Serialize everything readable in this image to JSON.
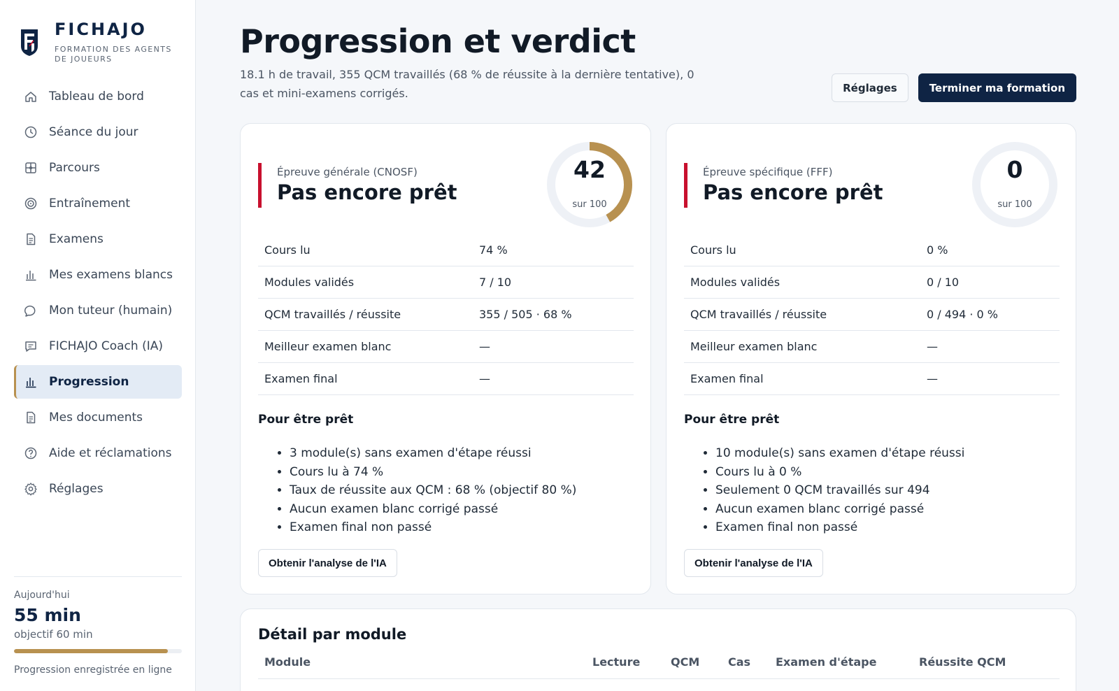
{
  "brand": {
    "name": "FICHAJO",
    "tagline": "FORMATION DES AGENTS DE JOUEURS",
    "colors": {
      "navy": "#0f2444",
      "gold": "#b89150",
      "red": "#c8102e"
    }
  },
  "sidebar": {
    "items": [
      {
        "label": "Tableau de bord",
        "icon": "home-icon",
        "active": false
      },
      {
        "label": "Séance du jour",
        "icon": "clock-icon",
        "active": false
      },
      {
        "label": "Parcours",
        "icon": "route-icon",
        "active": false
      },
      {
        "label": "Entraînement",
        "icon": "target-icon",
        "active": false
      },
      {
        "label": "Examens",
        "icon": "document-icon",
        "active": false
      },
      {
        "label": "Mes examens blancs",
        "icon": "bar-chart-icon",
        "active": false
      },
      {
        "label": "Mon tuteur (humain)",
        "icon": "chat-bubble-icon",
        "active": false
      },
      {
        "label": "FICHAJO Coach (IA)",
        "icon": "message-square-icon",
        "active": false
      },
      {
        "label": "Progression",
        "icon": "bar-chart-icon",
        "active": true
      },
      {
        "label": "Mes documents",
        "icon": "document-icon",
        "active": false
      },
      {
        "label": "Aide et réclamations",
        "icon": "help-circle-icon",
        "active": false
      },
      {
        "label": "Réglages",
        "icon": "gear-icon",
        "active": false
      }
    ],
    "today": {
      "label": "Aujourd'hui",
      "value": "55 min",
      "goal": "objectif 60 min",
      "progress_fraction": 0.9167,
      "sync": "Progression enregistrée en ligne"
    }
  },
  "header": {
    "title": "Progression et verdict",
    "subtitle": "18.1 h de travail, 355 QCM travaillés (68 % de réussite à la dernière tentative), 0 cas et mini-examens corrigés.",
    "settings_label": "Réglages",
    "finish_label": "Terminer ma formation"
  },
  "exams": [
    {
      "label": "Épreuve générale (CNOSF)",
      "verdict": "Pas encore prêt",
      "score": 42,
      "score_unit": "sur 100",
      "score_max": 100,
      "stats": [
        {
          "key": "Cours lu",
          "value": "74 %"
        },
        {
          "key": "Modules validés",
          "value": "7 / 10"
        },
        {
          "key": "QCM travaillés / réussite",
          "value": "355 / 505 · 68 %"
        },
        {
          "key": "Meilleur examen blanc",
          "value": "—"
        },
        {
          "key": "Examen final",
          "value": "—"
        }
      ],
      "ready_title": "Pour être prêt",
      "ready_items": [
        "3 module(s) sans examen d'étape réussi",
        "Cours lu à 74 %",
        "Taux de réussite aux QCM : 68 % (objectif 80 %)",
        "Aucun examen blanc corrigé passé",
        "Examen final non passé"
      ],
      "ai_label": "Obtenir l'analyse de l'IA"
    },
    {
      "label": "Épreuve spécifique (FFF)",
      "verdict": "Pas encore prêt",
      "score": 0,
      "score_unit": "sur 100",
      "score_max": 100,
      "stats": [
        {
          "key": "Cours lu",
          "value": "0 %"
        },
        {
          "key": "Modules validés",
          "value": "0 / 10"
        },
        {
          "key": "QCM travaillés / réussite",
          "value": "0 / 494 · 0 %"
        },
        {
          "key": "Meilleur examen blanc",
          "value": "—"
        },
        {
          "key": "Examen final",
          "value": "—"
        }
      ],
      "ready_title": "Pour être prêt",
      "ready_items": [
        "10 module(s) sans examen d'étape réussi",
        "Cours lu à 0 %",
        "Seulement 0 QCM travaillés sur 494",
        "Aucun examen blanc corrigé passé",
        "Examen final non passé"
      ],
      "ai_label": "Obtenir l'analyse de l'IA"
    }
  ],
  "modules": {
    "title": "Détail par module",
    "columns": [
      "Module",
      "Lecture",
      "QCM",
      "Cas",
      "Examen d'étape",
      "Réussite QCM"
    ]
  }
}
